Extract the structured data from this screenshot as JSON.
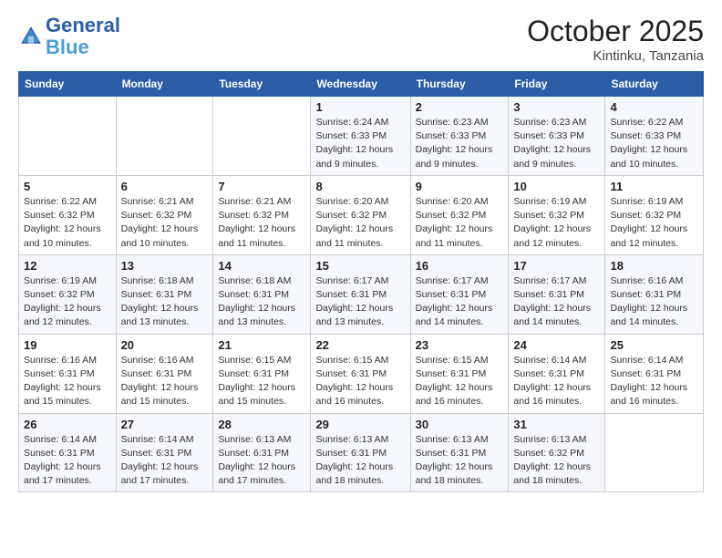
{
  "header": {
    "logo_line1": "General",
    "logo_line2": "Blue",
    "month": "October 2025",
    "location": "Kintinku, Tanzania"
  },
  "weekdays": [
    "Sunday",
    "Monday",
    "Tuesday",
    "Wednesday",
    "Thursday",
    "Friday",
    "Saturday"
  ],
  "weeks": [
    [
      {
        "day": "",
        "info": ""
      },
      {
        "day": "",
        "info": ""
      },
      {
        "day": "",
        "info": ""
      },
      {
        "day": "1",
        "info": "Sunrise: 6:24 AM\nSunset: 6:33 PM\nDaylight: 12 hours\nand 9 minutes."
      },
      {
        "day": "2",
        "info": "Sunrise: 6:23 AM\nSunset: 6:33 PM\nDaylight: 12 hours\nand 9 minutes."
      },
      {
        "day": "3",
        "info": "Sunrise: 6:23 AM\nSunset: 6:33 PM\nDaylight: 12 hours\nand 9 minutes."
      },
      {
        "day": "4",
        "info": "Sunrise: 6:22 AM\nSunset: 6:33 PM\nDaylight: 12 hours\nand 10 minutes."
      }
    ],
    [
      {
        "day": "5",
        "info": "Sunrise: 6:22 AM\nSunset: 6:32 PM\nDaylight: 12 hours\nand 10 minutes."
      },
      {
        "day": "6",
        "info": "Sunrise: 6:21 AM\nSunset: 6:32 PM\nDaylight: 12 hours\nand 10 minutes."
      },
      {
        "day": "7",
        "info": "Sunrise: 6:21 AM\nSunset: 6:32 PM\nDaylight: 12 hours\nand 11 minutes."
      },
      {
        "day": "8",
        "info": "Sunrise: 6:20 AM\nSunset: 6:32 PM\nDaylight: 12 hours\nand 11 minutes."
      },
      {
        "day": "9",
        "info": "Sunrise: 6:20 AM\nSunset: 6:32 PM\nDaylight: 12 hours\nand 11 minutes."
      },
      {
        "day": "10",
        "info": "Sunrise: 6:19 AM\nSunset: 6:32 PM\nDaylight: 12 hours\nand 12 minutes."
      },
      {
        "day": "11",
        "info": "Sunrise: 6:19 AM\nSunset: 6:32 PM\nDaylight: 12 hours\nand 12 minutes."
      }
    ],
    [
      {
        "day": "12",
        "info": "Sunrise: 6:19 AM\nSunset: 6:32 PM\nDaylight: 12 hours\nand 12 minutes."
      },
      {
        "day": "13",
        "info": "Sunrise: 6:18 AM\nSunset: 6:31 PM\nDaylight: 12 hours\nand 13 minutes."
      },
      {
        "day": "14",
        "info": "Sunrise: 6:18 AM\nSunset: 6:31 PM\nDaylight: 12 hours\nand 13 minutes."
      },
      {
        "day": "15",
        "info": "Sunrise: 6:17 AM\nSunset: 6:31 PM\nDaylight: 12 hours\nand 13 minutes."
      },
      {
        "day": "16",
        "info": "Sunrise: 6:17 AM\nSunset: 6:31 PM\nDaylight: 12 hours\nand 14 minutes."
      },
      {
        "day": "17",
        "info": "Sunrise: 6:17 AM\nSunset: 6:31 PM\nDaylight: 12 hours\nand 14 minutes."
      },
      {
        "day": "18",
        "info": "Sunrise: 6:16 AM\nSunset: 6:31 PM\nDaylight: 12 hours\nand 14 minutes."
      }
    ],
    [
      {
        "day": "19",
        "info": "Sunrise: 6:16 AM\nSunset: 6:31 PM\nDaylight: 12 hours\nand 15 minutes."
      },
      {
        "day": "20",
        "info": "Sunrise: 6:16 AM\nSunset: 6:31 PM\nDaylight: 12 hours\nand 15 minutes."
      },
      {
        "day": "21",
        "info": "Sunrise: 6:15 AM\nSunset: 6:31 PM\nDaylight: 12 hours\nand 15 minutes."
      },
      {
        "day": "22",
        "info": "Sunrise: 6:15 AM\nSunset: 6:31 PM\nDaylight: 12 hours\nand 16 minutes."
      },
      {
        "day": "23",
        "info": "Sunrise: 6:15 AM\nSunset: 6:31 PM\nDaylight: 12 hours\nand 16 minutes."
      },
      {
        "day": "24",
        "info": "Sunrise: 6:14 AM\nSunset: 6:31 PM\nDaylight: 12 hours\nand 16 minutes."
      },
      {
        "day": "25",
        "info": "Sunrise: 6:14 AM\nSunset: 6:31 PM\nDaylight: 12 hours\nand 16 minutes."
      }
    ],
    [
      {
        "day": "26",
        "info": "Sunrise: 6:14 AM\nSunset: 6:31 PM\nDaylight: 12 hours\nand 17 minutes."
      },
      {
        "day": "27",
        "info": "Sunrise: 6:14 AM\nSunset: 6:31 PM\nDaylight: 12 hours\nand 17 minutes."
      },
      {
        "day": "28",
        "info": "Sunrise: 6:13 AM\nSunset: 6:31 PM\nDaylight: 12 hours\nand 17 minutes."
      },
      {
        "day": "29",
        "info": "Sunrise: 6:13 AM\nSunset: 6:31 PM\nDaylight: 12 hours\nand 18 minutes."
      },
      {
        "day": "30",
        "info": "Sunrise: 6:13 AM\nSunset: 6:31 PM\nDaylight: 12 hours\nand 18 minutes."
      },
      {
        "day": "31",
        "info": "Sunrise: 6:13 AM\nSunset: 6:32 PM\nDaylight: 12 hours\nand 18 minutes."
      },
      {
        "day": "",
        "info": ""
      }
    ]
  ]
}
